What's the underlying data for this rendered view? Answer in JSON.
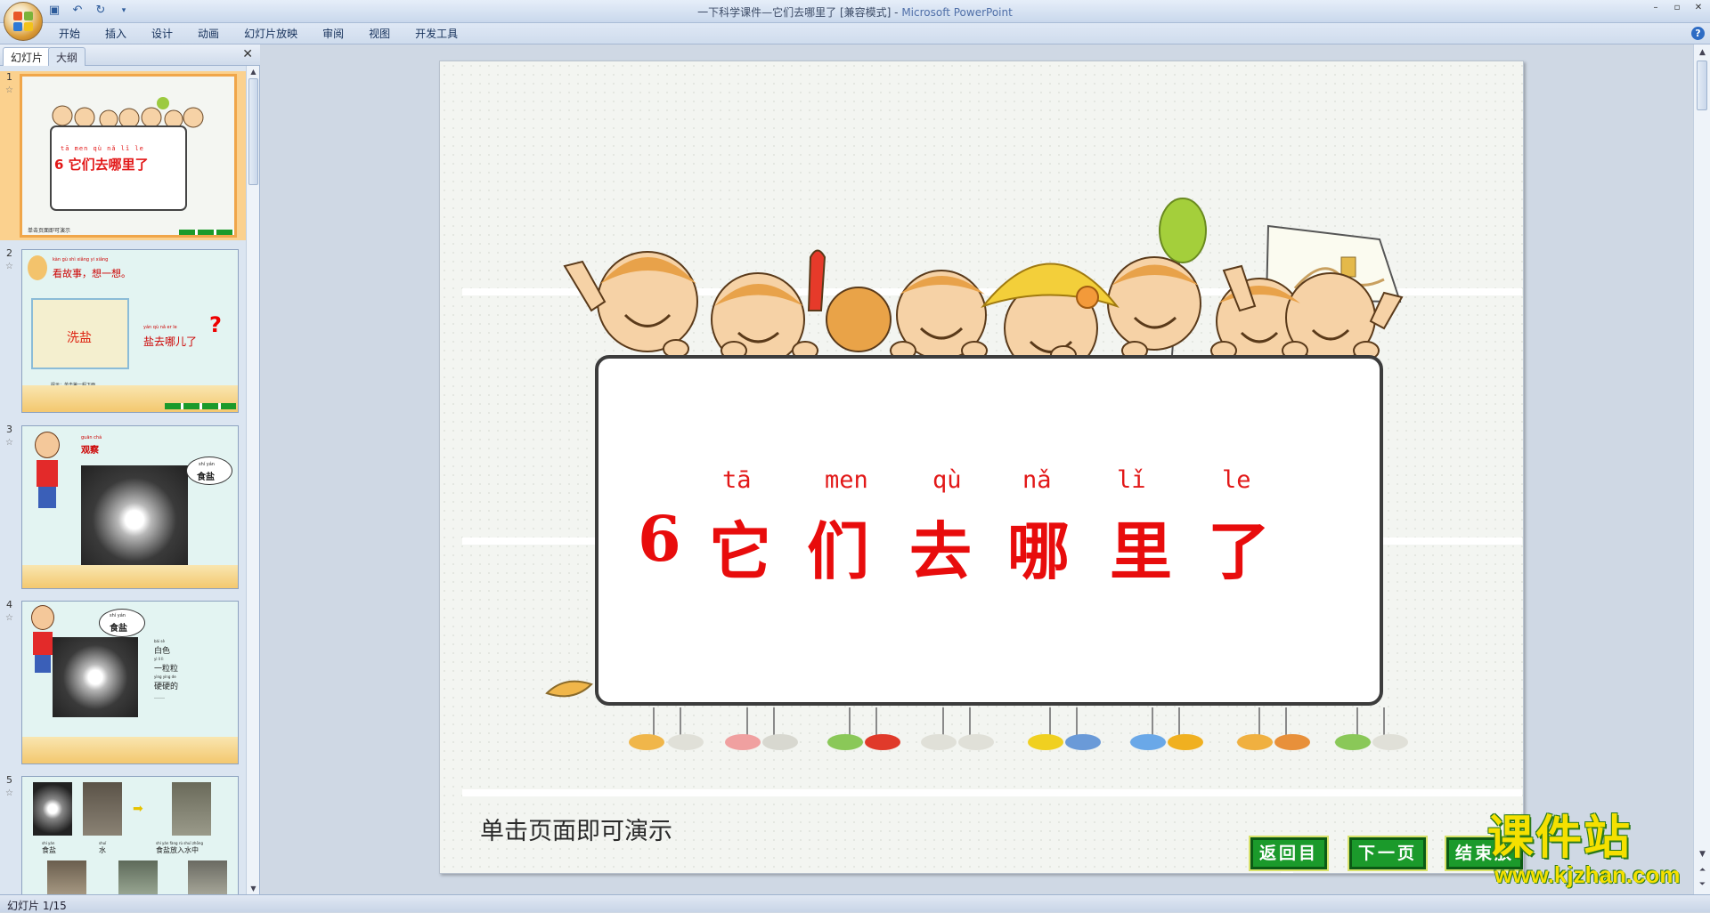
{
  "window": {
    "title_doc": "一下科学课件—它们去哪里了 [兼容模式] - ",
    "title_app": "Microsoft PowerPoint",
    "controls": [
      "–",
      "▫",
      "✕"
    ]
  },
  "quick_access": [
    "save-icon",
    "undo-icon",
    "redo-icon",
    "customize-icon"
  ],
  "menu": {
    "tabs": [
      "开始",
      "插入",
      "设计",
      "动画",
      "幻灯片放映",
      "审阅",
      "视图",
      "开发工具"
    ],
    "help": "?"
  },
  "left_pane": {
    "tabs": [
      "幻灯片",
      "大纲"
    ],
    "close": "✕",
    "slides": [
      {
        "num": "1",
        "title": "6 它们去哪里了",
        "pinyin": "tā men qù nǎ lǐ le",
        "hint": "单击页面即可演示"
      },
      {
        "num": "2",
        "heading_pinyin": "kàn gù shì  xiǎng yi xiǎng",
        "heading": "看故事，想一想。",
        "board": "洗盐",
        "question_pinyin": "yán qù nǎ er le",
        "question": "盐去哪儿了",
        "qmark": "?",
        "note": "提示：单击第一幅下面"
      },
      {
        "num": "3",
        "heading_pinyin": "guān chá",
        "heading": "观察",
        "bubble_pinyin": "shí yán",
        "bubble": "食盐"
      },
      {
        "num": "4",
        "bubble_pinyin": "shí yán",
        "bubble": "食盐",
        "props": [
          {
            "pinyin": "bái sè",
            "text": "白色"
          },
          {
            "pinyin": "yì lì lì",
            "text": "一粒粒"
          },
          {
            "pinyin": "yìng yìng de",
            "text": "硬硬的"
          },
          {
            "pinyin": "",
            "text": "……"
          }
        ]
      },
      {
        "num": "5",
        "labels": [
          {
            "pinyin": "shí yán",
            "text": "食盐"
          },
          {
            "pinyin": "shuǐ",
            "text": "水"
          },
          {
            "pinyin": "shí yán fàng rù shuǐ zhōng",
            "text": "食盐放入水中"
          }
        ]
      }
    ]
  },
  "slide": {
    "pinyin": [
      "tā",
      "men",
      "qù",
      "nǎ",
      "lǐ",
      "le"
    ],
    "number": "6",
    "chars": [
      "它",
      "们",
      "去",
      "哪",
      "里",
      "了"
    ],
    "hint": "单击页面即可演示",
    "nav_buttons": [
      "返回目录",
      "下一页",
      "结束放"
    ]
  },
  "status": {
    "slide_counter": "幻灯片 1/15"
  },
  "watermark": {
    "brand": "课件站",
    "url": "www.kjzhan.com"
  }
}
